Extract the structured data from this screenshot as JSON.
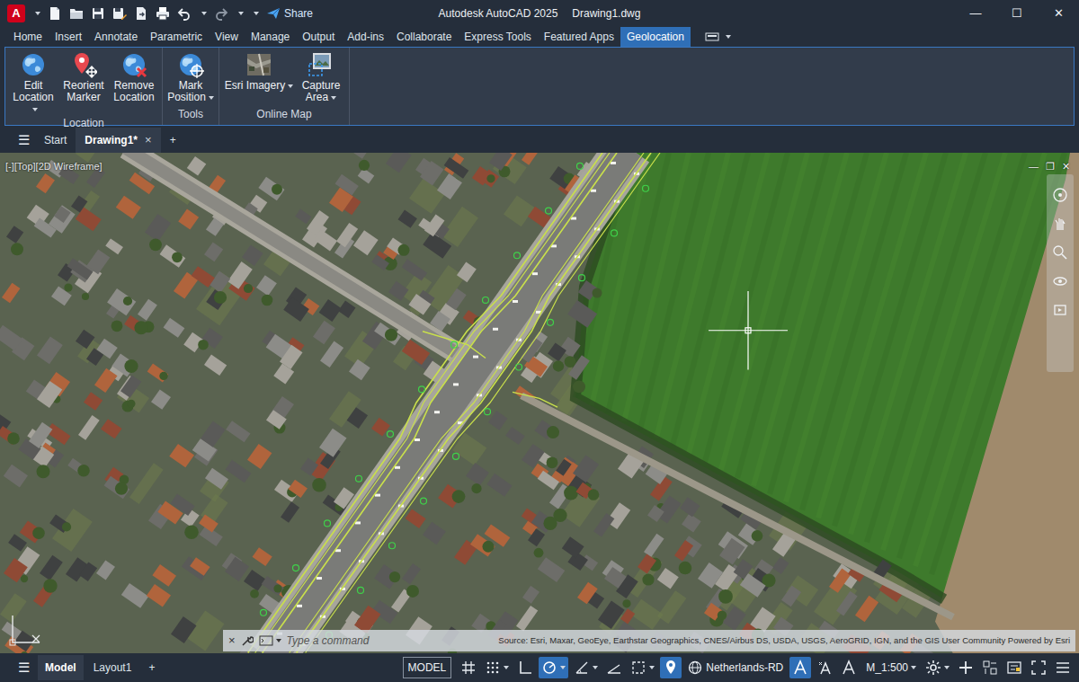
{
  "window": {
    "logo": "A",
    "title": "Autodesk AutoCAD 2025",
    "document": "Drawing1.dwg",
    "controls": [
      {
        "kind": "minimize",
        "label": "—"
      },
      {
        "kind": "maximize",
        "label": "☐"
      },
      {
        "kind": "close",
        "label": "✕"
      }
    ]
  },
  "quick_access": {
    "share": "Share"
  },
  "ribbon": {
    "tabs": [
      {
        "label": "Home",
        "selected": false
      },
      {
        "label": "Insert",
        "selected": false
      },
      {
        "label": "Annotate",
        "selected": false
      },
      {
        "label": "Parametric",
        "selected": false
      },
      {
        "label": "View",
        "selected": false
      },
      {
        "label": "Manage",
        "selected": false
      },
      {
        "label": "Output",
        "selected": false
      },
      {
        "label": "Add-ins",
        "selected": false
      },
      {
        "label": "Collaborate",
        "selected": false
      },
      {
        "label": "Express Tools",
        "selected": false
      },
      {
        "label": "Featured Apps",
        "selected": false
      },
      {
        "label": "Geolocation",
        "selected": true
      }
    ],
    "panels": [
      {
        "title": "Location",
        "buttons": [
          {
            "label": "Edit Location",
            "kind": "edit-location",
            "dropdown": true
          },
          {
            "label": "Reorient Marker",
            "kind": "reorient-marker",
            "dropdown": false
          },
          {
            "label": "Remove Location",
            "kind": "remove-location",
            "dropdown": false
          }
        ]
      },
      {
        "title": "Tools",
        "buttons": [
          {
            "label": "Mark Position",
            "kind": "mark-position",
            "dropdown": true
          }
        ]
      },
      {
        "title": "Online Map",
        "buttons": [
          {
            "label": "Esri Imagery",
            "kind": "esri-imagery",
            "dropdown": true
          },
          {
            "label": "Capture Area",
            "kind": "capture-area",
            "dropdown": true
          }
        ]
      }
    ]
  },
  "file_tabs": {
    "menu": "☰",
    "tabs": [
      {
        "label": "Start",
        "selected": false
      },
      {
        "label": "Drawing1*",
        "selected": true,
        "close": "×"
      }
    ],
    "add": "+"
  },
  "viewport": {
    "label": "[-][Top][2D Wireframe]",
    "controls": [
      "—",
      "❐",
      "✕"
    ]
  },
  "command_line": {
    "close": "×",
    "placeholder": "Type a command"
  },
  "map": {
    "attribution": "Source: Esri, Maxar, GeoEye, Earthstar Geographics, CNES/Airbus DS, USDA, USGS, AeroGRID, IGN, and the GIS User Community Powered by Esri"
  },
  "status_bar": {
    "menu": "☰",
    "layout_tabs": [
      {
        "label": "Model",
        "selected": true
      },
      {
        "label": "Layout1",
        "selected": false
      }
    ],
    "add": "+",
    "space": "MODEL",
    "drafting_tools": [
      {
        "kind": "grid",
        "on": false,
        "dropdown": false
      },
      {
        "kind": "snap",
        "on": false,
        "dropdown": true
      },
      {
        "kind": "ortho",
        "on": false,
        "dropdown": false
      },
      {
        "kind": "polar",
        "on": true,
        "dropdown": true
      },
      {
        "kind": "isodraft",
        "on": false,
        "dropdown": true
      },
      {
        "kind": "osnap",
        "on": false,
        "dropdown": false
      },
      {
        "kind": "selection",
        "on": false,
        "dropdown": true
      },
      {
        "kind": "geomarker",
        "on": true,
        "dropdown": false
      }
    ],
    "coordinate_system": "Netherlands-RD",
    "annotation_tools": [
      {
        "kind": "annot-visibility",
        "on": true,
        "dropdown": false
      },
      {
        "kind": "autoscale",
        "on": false,
        "dropdown": false
      },
      {
        "kind": "annot-scale",
        "on": false,
        "dropdown": false
      }
    ],
    "scale": "M_1:500",
    "workspace_tools": [
      {
        "kind": "workspace",
        "on": false,
        "dropdown": true
      },
      {
        "kind": "annot-monitor",
        "on": false,
        "dropdown": false
      },
      {
        "kind": "units",
        "on": false,
        "dropdown": false
      },
      {
        "kind": "quick-props",
        "on": false,
        "dropdown": false
      },
      {
        "kind": "fullscreen",
        "on": false,
        "dropdown": false
      },
      {
        "kind": "customize",
        "on": false,
        "dropdown": false
      }
    ]
  }
}
